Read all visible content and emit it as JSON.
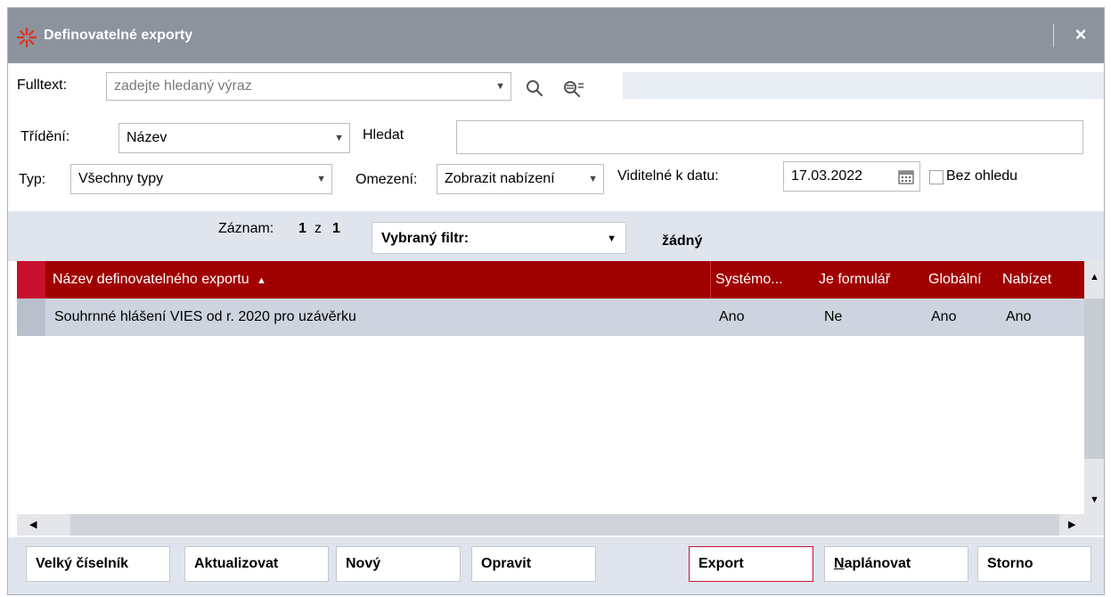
{
  "window": {
    "title": "Definovatelné exporty",
    "close_label": "×"
  },
  "filters": {
    "fulltext_label": "Fulltext:",
    "fulltext_placeholder": "zadejte hledaný výraz",
    "sort_label": "Třídění:",
    "sort_value": "Název",
    "search_label": "Hledat",
    "search_value": "",
    "type_label": "Typ:",
    "type_value": "Všechny typy",
    "restriction_label": "Omezení:",
    "restriction_value": "Zobrazit nabízení",
    "visible_date_label": "Viditelné k datu:",
    "visible_date_value": "17.03.2022",
    "ignore_label": "Bez ohledu"
  },
  "navigator": {
    "record_label": "Záznam:",
    "record_current": "1",
    "record_of": "z",
    "record_total": "1",
    "filter_label": "Vybraný filtr:",
    "filter_value": "žádný"
  },
  "grid": {
    "columns": [
      "Název definovatelného exportu",
      "Systémo...",
      "Je formulář",
      "Globální",
      "Nabízet"
    ],
    "sort_indicator": "▲",
    "rows": [
      {
        "name": "Souhrnné hlášení VIES od r. 2020 pro uzávěrku",
        "system": "Ano",
        "form": "Ne",
        "global": "Ano",
        "offer": "Ano"
      }
    ]
  },
  "buttons": {
    "big_list": "Velký číselník",
    "refresh": "Aktualizovat",
    "new": "Nový",
    "edit": "Opravit",
    "export": "Export",
    "schedule": "Naplánovat",
    "cancel": "Storno"
  },
  "colors": {
    "title_bar": "#8c939d",
    "grid_header": "#a00000",
    "accent": "#c8102e"
  }
}
